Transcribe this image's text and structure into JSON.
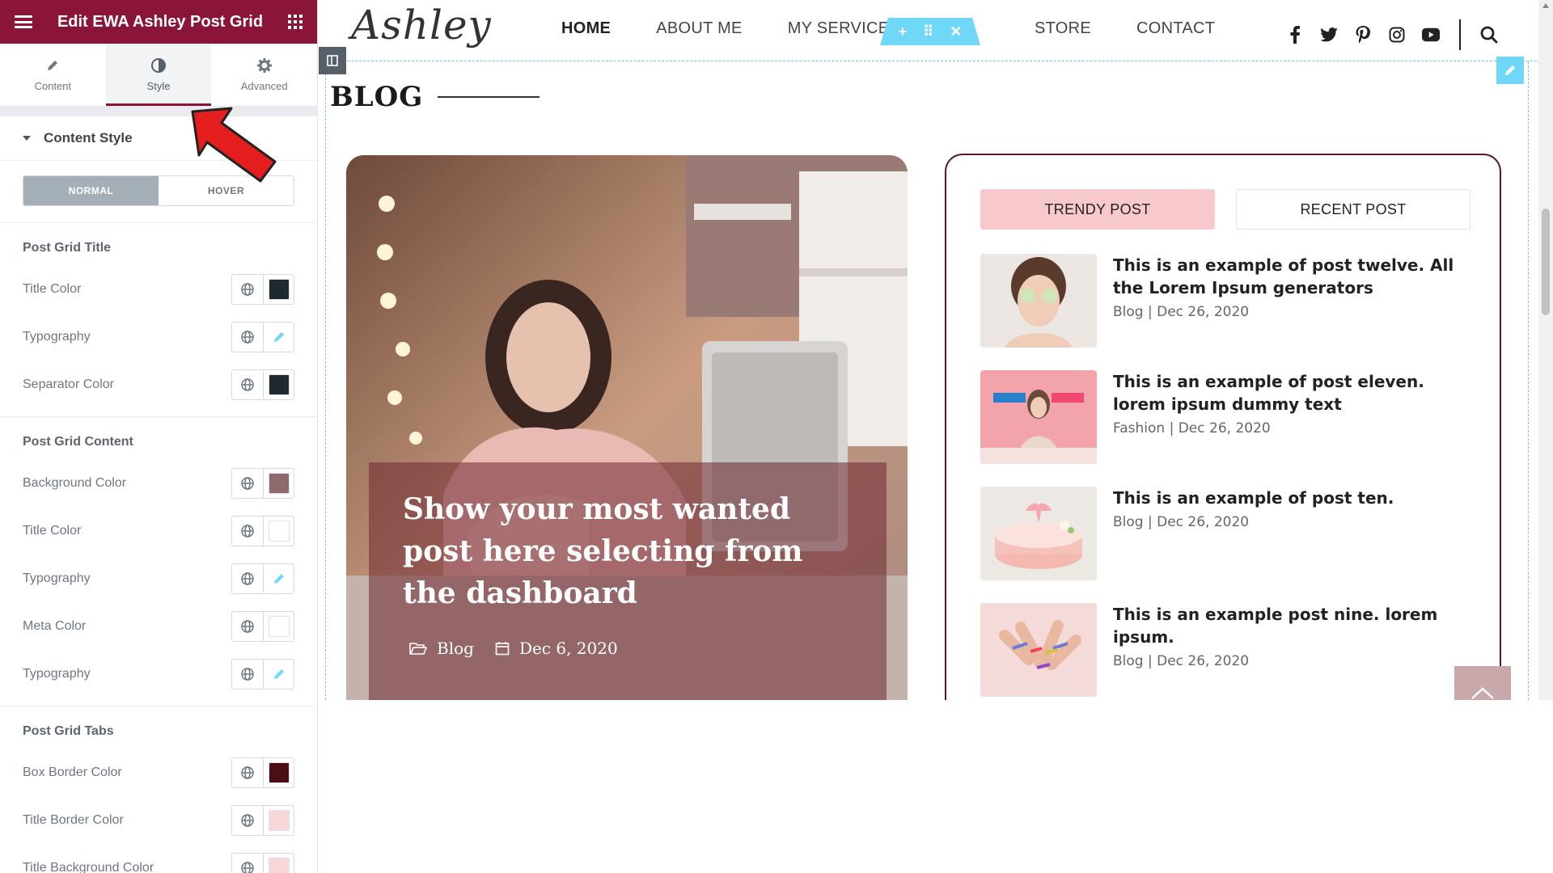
{
  "panel": {
    "title": "Edit EWA Ashley Post Grid",
    "tabs": [
      {
        "label": "Content",
        "icon": "pencil-icon"
      },
      {
        "label": "Style",
        "icon": "half-circle-icon"
      },
      {
        "label": "Advanced",
        "icon": "gear-icon"
      }
    ],
    "active_tab": "Style",
    "section_title": "Content Style",
    "state_normal": "NORMAL",
    "state_hover": "HOVER",
    "groups": {
      "title": {
        "heading": "Post Grid Title",
        "controls": [
          {
            "label": "Title Color",
            "value": "#1f2a30"
          },
          {
            "label": "Typography"
          },
          {
            "label": "Separator Color",
            "value": "#1f2a30"
          }
        ]
      },
      "content": {
        "heading": "Post Grid Content",
        "controls": [
          {
            "label": "Background Color",
            "value": "#8e6a6e"
          },
          {
            "label": "Title Color",
            "value": "#ffffff"
          },
          {
            "label": "Typography"
          },
          {
            "label": "Meta Color",
            "value": "#ffffff"
          },
          {
            "label": "Typography"
          }
        ]
      },
      "tabs": {
        "heading": "Post Grid Tabs",
        "controls": [
          {
            "label": "Box Border Color",
            "value": "#4a0e14"
          },
          {
            "label": "Title Border Color",
            "value": "#f8d7da"
          },
          {
            "label": "Title Background Color",
            "value": "#f8d7da"
          }
        ]
      }
    },
    "accent_color": "#8b1538"
  },
  "site": {
    "logo": "Ashley",
    "nav": [
      "HOME",
      "ABOUT ME",
      "MY SERVICES",
      "STORE",
      "CONTACT"
    ],
    "active_nav": "HOME",
    "social_icons": [
      "facebook-icon",
      "twitter-icon",
      "pinterest-icon",
      "instagram-icon",
      "youtube-icon"
    ],
    "blog_heading": "BLOG"
  },
  "featured": {
    "title": "Show your most wanted post here selecting from the dashboard",
    "category": "Blog",
    "date": "Dec 6, 2020"
  },
  "tabs": {
    "trendy": "TRENDY POST",
    "recent": "RECENT POST"
  },
  "posts": [
    {
      "title": "This is an example of post twelve. All the Lorem Ipsum generators",
      "meta": "Blog | Dec 26, 2020"
    },
    {
      "title": "This is an example of post eleven. lorem ipsum dummy text",
      "meta": "Fashion | Dec 26, 2020"
    },
    {
      "title": "This is an example of post ten.",
      "meta": "Blog | Dec 26, 2020"
    },
    {
      "title": "This is an example post nine. lorem ipsum.",
      "meta": "Blog | Dec 26, 2020"
    }
  ]
}
